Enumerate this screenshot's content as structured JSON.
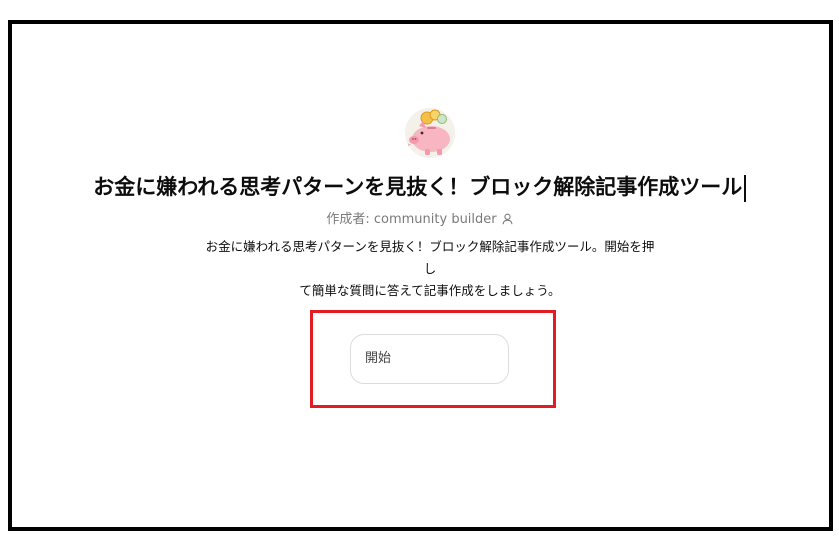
{
  "gpt": {
    "title": "お金に嫌われる思考パターンを見抜く！ブロック解除記事作成ツール",
    "author_label": "作成者: community builder",
    "description_line1": "お金に嫌われる思考パターンを見抜く！ブロック解除記事作成ツール。開始を押し",
    "description_line2": "て簡単な質問に答えて記事作成をしましょう。",
    "avatar_icon": "piggy-bank-icon",
    "author_icon": "user-icon"
  },
  "conversation_starters": [
    {
      "label": "開始"
    }
  ],
  "colors": {
    "frame_border": "#000000",
    "highlight_border": "#e31b23",
    "text_primary": "#0d0d0d",
    "text_secondary": "#7a7a7a",
    "button_border": "#dcdcdc",
    "piggy_pink": "#f7b6c2",
    "coin_gold": "#f5c04a"
  }
}
